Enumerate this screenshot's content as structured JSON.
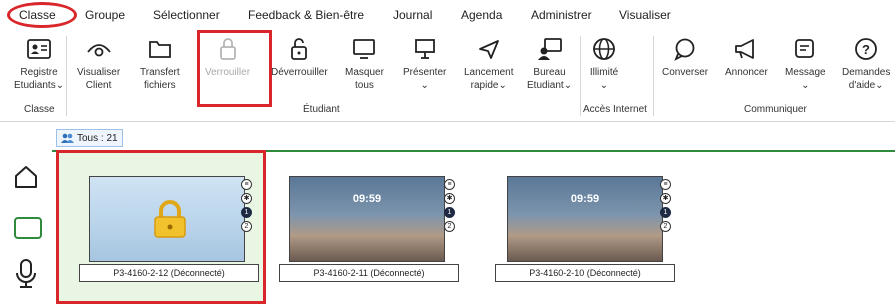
{
  "menu": {
    "items": [
      {
        "label": "Classe",
        "active": true
      },
      {
        "label": "Groupe"
      },
      {
        "label": "Sélectionner"
      },
      {
        "label": "Feedback & Bien-être"
      },
      {
        "label": "Journal"
      },
      {
        "label": "Agenda"
      },
      {
        "label": "Administrer"
      },
      {
        "label": "Visualiser"
      }
    ]
  },
  "ribbon": {
    "registre": {
      "line1": "Registre",
      "line2": "Etudiants",
      "icon": "id-card-icon"
    },
    "visualiser": {
      "line1": "Visualiser",
      "line2": "Client",
      "icon": "eye-icon"
    },
    "transfert": {
      "line1": "Transfert",
      "line2": "fichiers",
      "icon": "folder-icon"
    },
    "verrouiller": {
      "line1": "Verrouiller",
      "icon": "padlock-icon",
      "disabled": true
    },
    "deverrouiller": {
      "line1": "Déverrouiller",
      "icon": "unlock-icon"
    },
    "masquer": {
      "line1": "Masquer",
      "line2": "tous",
      "icon": "monitor-icon"
    },
    "presenter": {
      "line1": "Présenter",
      "line2": "⌄",
      "icon": "presentation-icon"
    },
    "lancement": {
      "line1": "Lancement",
      "line2": "rapide",
      "icon": "send-icon"
    },
    "bureau": {
      "line1": "Bureau",
      "line2": "Etudiant",
      "icon": "student-desk-icon"
    },
    "illimite": {
      "line1": "Illimité",
      "line2": "⌄",
      "icon": "globe-icon"
    },
    "converser": {
      "line1": "Converser",
      "icon": "chat-bubble-icon"
    },
    "annoncer": {
      "line1": "Annoncer",
      "icon": "megaphone-icon"
    },
    "message": {
      "line1": "Message",
      "line2": "⌄",
      "icon": "message-edit-icon"
    },
    "demandes": {
      "line1": "Demandes",
      "line2": "d'aide",
      "icon": "help-icon"
    },
    "groups": {
      "classe": "Classe",
      "etudiant": "Étudiant",
      "acces": "Accès Internet",
      "communiquer": "Communiquer"
    }
  },
  "filter": {
    "label": "Tous : 21"
  },
  "tiles": [
    {
      "caption": "P3-4160-2-12 (Déconnecté)",
      "locked": true
    },
    {
      "caption": "P3-4160-2-11 (Déconnecté)",
      "clock": "09:59"
    },
    {
      "caption": "P3-4160-2-10 (Déconnecté)",
      "clock": "09:59"
    }
  ],
  "badges": [
    "≡",
    "✱",
    "1",
    "2"
  ],
  "colors": {
    "accent_red": "#d8262a",
    "accent_green": "#2e8b3e",
    "lock_yellow": "#f2c12e"
  }
}
